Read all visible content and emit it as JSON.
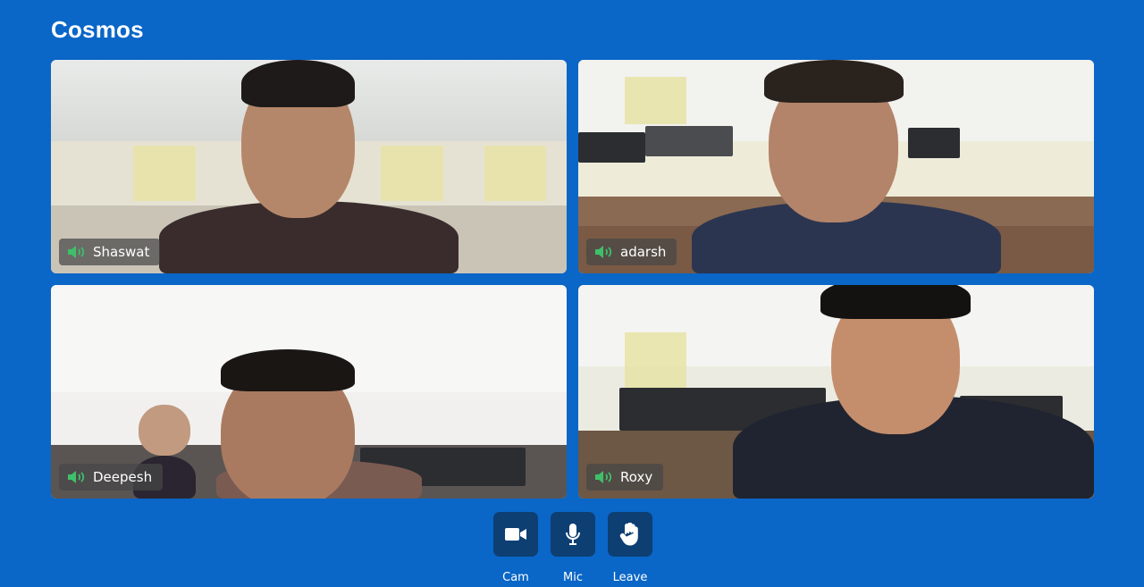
{
  "app": {
    "title": "Cosmos"
  },
  "participants": [
    {
      "name": "Shaswat"
    },
    {
      "name": "adarsh"
    },
    {
      "name": "Deepesh"
    },
    {
      "name": "Roxy"
    }
  ],
  "controls": [
    {
      "label": "Cam",
      "icon": "video-camera-icon"
    },
    {
      "label": "Mic",
      "icon": "microphone-icon"
    },
    {
      "label": "Leave",
      "icon": "hand-icon"
    }
  ],
  "colors": {
    "background": "#0a66c7",
    "control_button": "#0d3f73",
    "speaking_indicator": "#3fbf6a"
  }
}
